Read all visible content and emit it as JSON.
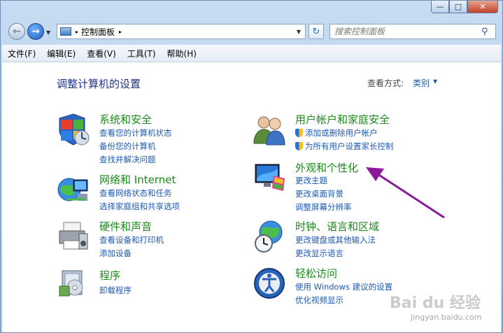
{
  "window": {
    "caption_min": "—",
    "caption_max": "□",
    "caption_close": "✕"
  },
  "address": {
    "path": "控制面板",
    "separator": "▸"
  },
  "search": {
    "placeholder": "搜索控制面板"
  },
  "menu": [
    "文件(F)",
    "编辑(E)",
    "查看(V)",
    "工具(T)",
    "帮助(H)"
  ],
  "main": {
    "title": "调整计算机的设置",
    "view_by_label": "查看方式:",
    "view_by_value": "类别"
  },
  "categories": {
    "system": {
      "title": "系统和安全",
      "links": [
        "查看您的计算机状态",
        "备份您的计算机",
        "查找并解决问题"
      ]
    },
    "network": {
      "title": "网络和 Internet",
      "links": [
        "查看网络状态和任务",
        "选择家庭组和共享选项"
      ]
    },
    "hardware": {
      "title": "硬件和声音",
      "links": [
        "查看设备和打印机",
        "添加设备"
      ]
    },
    "programs": {
      "title": "程序",
      "links": [
        "卸载程序"
      ]
    },
    "users": {
      "title": "用户帐户和家庭安全",
      "links": [
        "添加或删除用户帐户",
        "为所有用户设置家长控制"
      ]
    },
    "appearance": {
      "title": "外观和个性化",
      "links": [
        "更改主题",
        "更改桌面背景",
        "调整屏幕分辨率"
      ]
    },
    "clock": {
      "title": "时钟、语言和区域",
      "links": [
        "更改键盘或其他输入法",
        "更改显示语言"
      ]
    },
    "ease": {
      "title": "轻松访问",
      "links": [
        "使用 Windows 建议的设置",
        "优化视频显示"
      ]
    }
  },
  "watermark": {
    "logo": "Bai du 经验",
    "url": "jingyan.baidu.com"
  },
  "colors": {
    "category_title": "#1b8a1b",
    "link": "#1d5ab4",
    "page_title": "#1e3287",
    "annotation_arrow": "#8a1a9a"
  }
}
